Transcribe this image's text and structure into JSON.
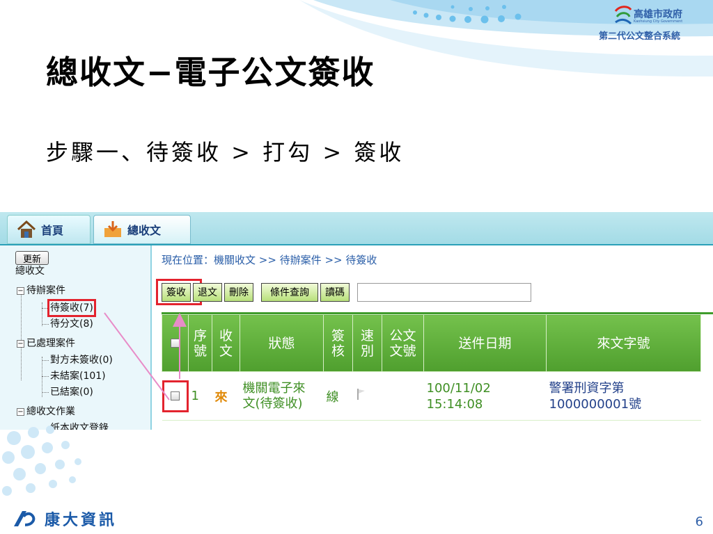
{
  "header": {
    "city_name": "高雄市政府",
    "city_sub": "Kaohsiung City Government",
    "system_name": "第二代公文整合系統"
  },
  "slide": {
    "title": "總收文−電子公文簽收",
    "subtitle": "步驟一、待簽收 > 打勾 > 簽收",
    "page_number": "6",
    "company_name": "康大資訊"
  },
  "tabs": [
    {
      "label": "首頁",
      "icon": "home-icon"
    },
    {
      "label": "總收文",
      "icon": "inbox-icon"
    }
  ],
  "sidebar": {
    "refresh_label": "更新",
    "root_label": "總收文",
    "tree": [
      {
        "label": "待辦案件",
        "toggle": "⊟"
      },
      {
        "label": "待簽收(7)"
      },
      {
        "label": "待分文(8)"
      },
      {
        "label": "已處理案件",
        "toggle": "⊟"
      },
      {
        "label": "對方未簽收(0)"
      },
      {
        "label": "未結案(101)"
      },
      {
        "label": "已結案(0)"
      },
      {
        "label": "總收文作業",
        "toggle": "⊟"
      },
      {
        "label": "紙本收文登錄"
      }
    ]
  },
  "main": {
    "breadcrumb": "現在位置：機關收文 >> 待辦案件 >> 待簽收",
    "toolbar": {
      "sign_label": "簽收",
      "return_label": "退文",
      "delete_label": "刪除",
      "query_label": "條件查詢",
      "read_code_label": "讀碼",
      "search_value": ""
    },
    "columns": [
      "序號",
      "收文",
      "狀態",
      "簽核",
      "速別",
      "公文文號",
      "送件日期",
      "來文字號"
    ],
    "column_display": {
      "seq": [
        "序",
        "號"
      ],
      "recv": [
        "收",
        "文"
      ],
      "status": "狀態",
      "sign": [
        "簽",
        "核"
      ],
      "speed": [
        "速",
        "別"
      ],
      "docno": [
        "公文",
        "文號"
      ],
      "date": "送件日期",
      "ref": "來文字號"
    },
    "rows": [
      {
        "seq": "1",
        "recv": "來",
        "status_line1": "機關電子來",
        "status_line2": "文(待簽收)",
        "sign": "線",
        "speed": "",
        "docno": "",
        "date_line1": "100/11/02",
        "date_line2": "15:14:08",
        "ref_line1": "警署刑資字第",
        "ref_line2": "1000000001號"
      }
    ]
  },
  "colors": {
    "accent_green": "#4f9f2e",
    "highlight_red": "#e3232e",
    "arrow_pink": "#e88cc8",
    "link_blue": "#2a5ea8"
  }
}
